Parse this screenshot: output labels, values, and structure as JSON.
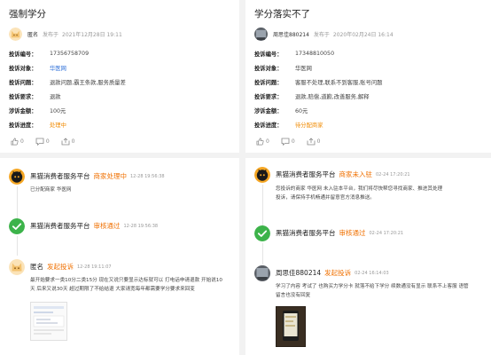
{
  "left": {
    "title": "强制学分",
    "author": {
      "name": "匿名",
      "posted_label": "发布于",
      "date": "2021年12月28日 19:11"
    },
    "rows": [
      {
        "key": "投诉编号：",
        "value": "17356758709"
      },
      {
        "key": "投诉对象：",
        "value": "华医网"
      },
      {
        "key": "投诉问题：",
        "value": "退款问题,霸王条款,服务质量差"
      },
      {
        "key": "投诉要求：",
        "value": "退款"
      },
      {
        "key": "涉诉金额：",
        "value": "100元"
      },
      {
        "key": "投诉进度：",
        "value": "处理中"
      }
    ],
    "actions": {
      "like": "0",
      "comment": "0",
      "share": "0"
    },
    "timeline": [
      {
        "name": "黑猫消费者服务平台",
        "status": "商家处理中",
        "time": "12-28 19:56:38",
        "body": "已分配商家 华医网"
      },
      {
        "name": "黑猫消费者服务平台",
        "status": "审核通过",
        "time": "12-28 19:56:38",
        "body": ""
      },
      {
        "name": "匿名",
        "status": "发起投诉",
        "time": "12-28 19:11:07",
        "body_lines": [
          "最开始要求一类10分二类15分 现在又说只要显示达标就可以 打电话申请退款 开始说10",
          "天 后来又说30天 超过期限了不给结退 大家请宽每年都需要学分要求来回变"
        ]
      }
    ]
  },
  "right": {
    "title": "学分落实不了",
    "author": {
      "name": "周思佳880214",
      "posted_label": "发布于",
      "date": "2020年02月24日 16:14"
    },
    "rows": [
      {
        "key": "投诉编号：",
        "value": "17348810050"
      },
      {
        "key": "投诉对象：",
        "value": "华医网"
      },
      {
        "key": "投诉问题：",
        "value": "客服不处理,联系不到客服,账号问题"
      },
      {
        "key": "投诉要求：",
        "value": "退款,赔偿,道歉,改善服务,解释"
      },
      {
        "key": "涉诉金额：",
        "value": "60元"
      },
      {
        "key": "投诉进度：",
        "value": "待分配商家"
      }
    ],
    "actions": {
      "like": "0",
      "comment": "0",
      "share": "0"
    },
    "timeline": [
      {
        "name": "黑猫消费者服务平台",
        "status": "商家未入驻",
        "time": "02-24 17:20:21",
        "body_lines": [
          "您投诉的商家 华医网 未入驻本平台，我们将尽快帮您寻找商家、推进其处理",
          "投诉，请保持手机畅通并留意官方消息推送。"
        ]
      },
      {
        "name": "黑猫消费者服务平台",
        "status": "审核通过",
        "time": "02-24 17:20:21",
        "body": ""
      },
      {
        "name": "周思佳880214",
        "status": "发起投诉",
        "time": "02-24 16:14:03",
        "body_lines": [
          "学习了内容 考试了 也购买力学分卡 就落不给下学分 续数通没有显示 联系不上客服 语管",
          "留言也没有回复"
        ]
      }
    ]
  },
  "colors": {
    "accent_orange": "#f07000",
    "link_blue": "#2d6fd8",
    "progress_orange": "#f08a00",
    "check_green": "#3cb34a"
  }
}
